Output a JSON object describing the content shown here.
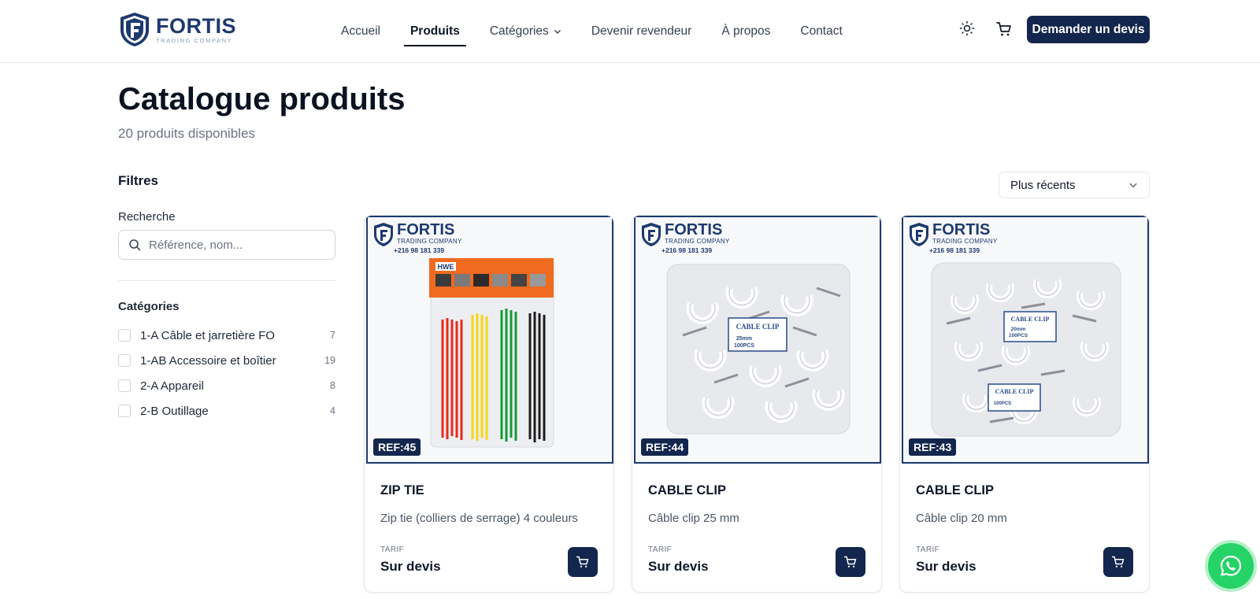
{
  "brand": {
    "name": "FORTIS",
    "tagline": "TRADING COMPANY"
  },
  "nav": {
    "items": [
      {
        "label": "Accueil",
        "active": false
      },
      {
        "label": "Produits",
        "active": true
      },
      {
        "label": "Catégories",
        "active": false
      },
      {
        "label": "Devenir revendeur",
        "active": false
      },
      {
        "label": "À propos",
        "active": false
      },
      {
        "label": "Contact",
        "active": false
      }
    ],
    "quote_button": "Demander un devis"
  },
  "page": {
    "title": "Catalogue produits",
    "subtitle": "20 produits disponibles"
  },
  "filters": {
    "title": "Filtres",
    "search_label": "Recherche",
    "search_placeholder": "Référence, nom...",
    "categories_title": "Catégories",
    "categories": [
      {
        "label": "1-A Câble et jarretière FO",
        "count": "7"
      },
      {
        "label": "1-AB Accessoire et boîtier",
        "count": "19"
      },
      {
        "label": "2-A Appareil",
        "count": "8"
      },
      {
        "label": "2-B Outillage",
        "count": "4"
      }
    ]
  },
  "sort": {
    "value": "Plus récents"
  },
  "products": [
    {
      "ref": "REF:45",
      "title": "ZIP TIE",
      "desc": "Zip tie (colliers de serrage) 4 couleurs",
      "price_label": "TARIF",
      "price": "Sur devis",
      "kind": "ziptie"
    },
    {
      "ref": "REF:44",
      "title": "CABLE CLIP",
      "desc": "Câble clip 25 mm",
      "price_label": "TARIF",
      "price": "Sur devis",
      "kind": "clip",
      "clip_size": "25mm",
      "clip_pcs": "100PCS"
    },
    {
      "ref": "REF:43",
      "title": "CABLE CLIP",
      "desc": "Câble clip 20 mm",
      "price_label": "TARIF",
      "price": "Sur devis",
      "kind": "clip",
      "clip_size": "20mm",
      "clip_pcs": "100PCS"
    }
  ],
  "watermark": {
    "brand": "FORTIS",
    "sub": "TRADING COMPANY",
    "phone": "+216 98 181 339"
  },
  "package": {
    "brand": "HWE",
    "clip_label": "CABLE CLIP"
  },
  "colors": {
    "navy": "#13264d",
    "brand_blue": "#1e3a6e",
    "whatsapp": "#25d366"
  }
}
